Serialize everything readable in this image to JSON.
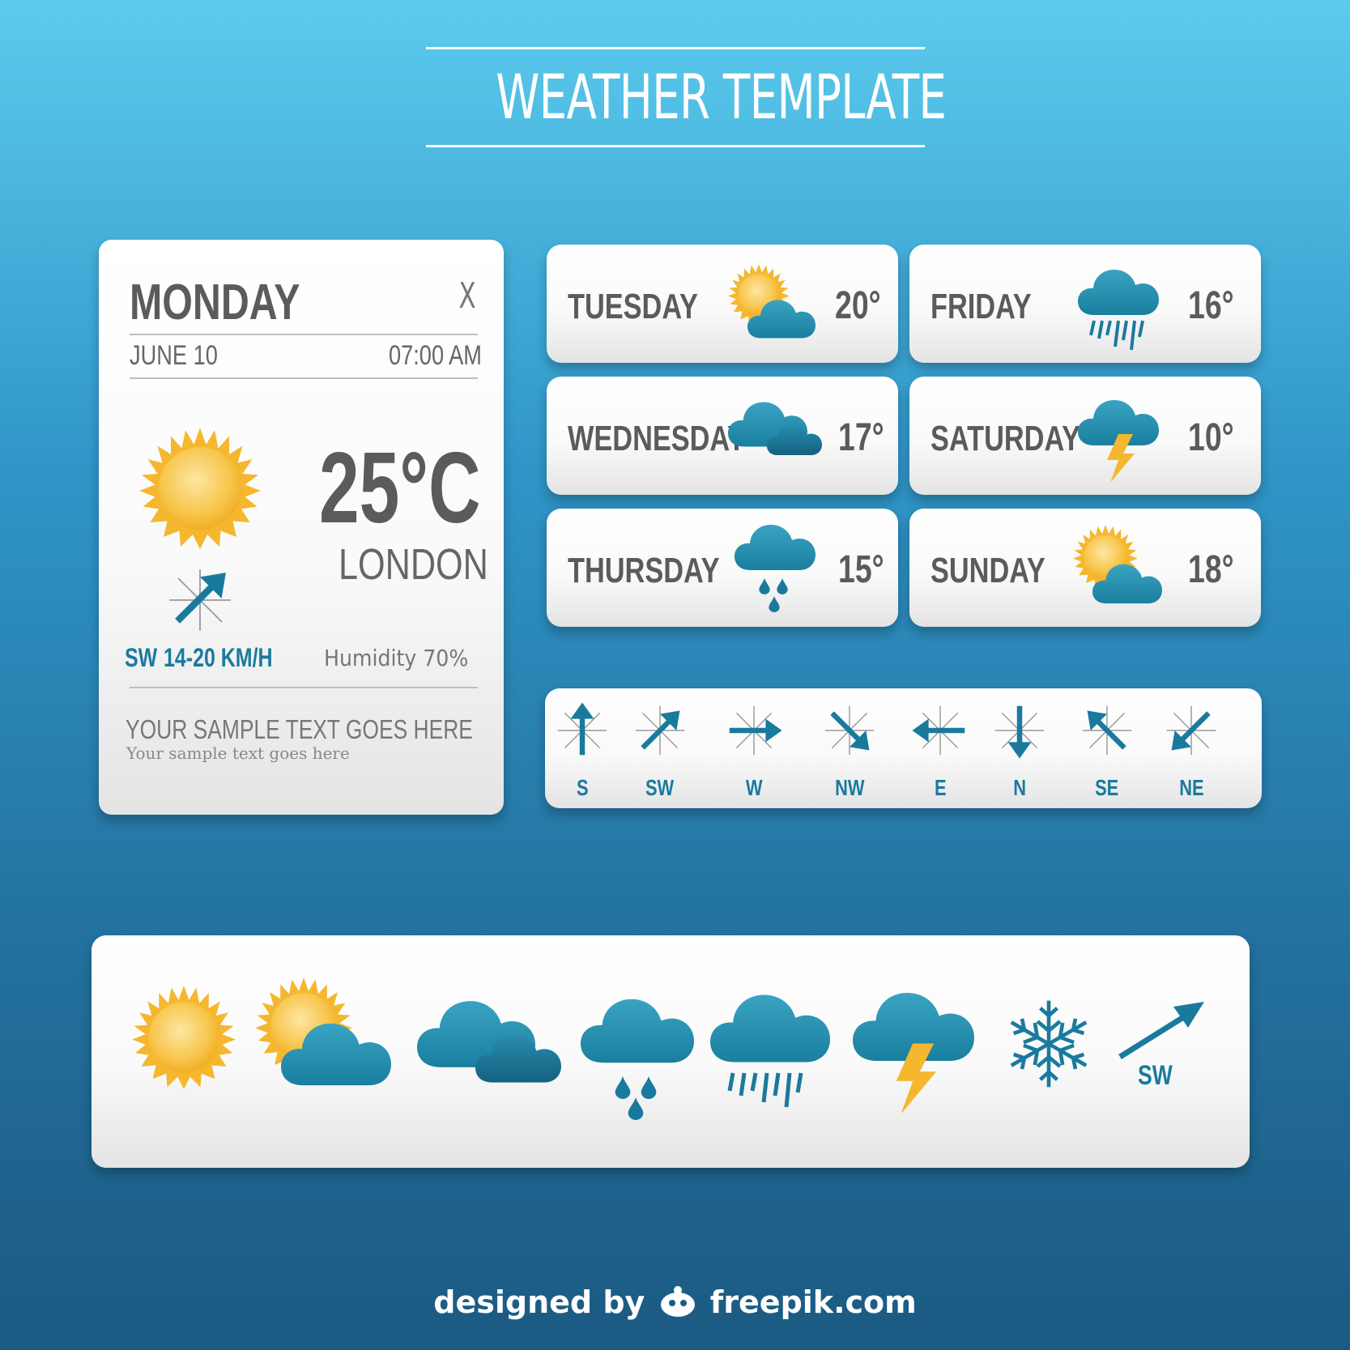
{
  "page": {
    "title": "WEATHER TEMPLATE"
  },
  "colors": {
    "teal": "#1a7a9e",
    "sun": "#f5b72e",
    "text_gray": "#5b5b5b",
    "bg_top": "#5ccbee",
    "bg_bottom": "#1b5a82"
  },
  "main_card": {
    "day": "MONDAY",
    "close": "X",
    "date": "JUNE 10",
    "time": "07:00 AM",
    "temperature": "25°C",
    "city": "LONDON",
    "wind_dir": "SW",
    "wind_speed": "14-20 KM/H",
    "humidity": "Humidity 70%",
    "sample_title": "YOUR SAMPLE TEXT GOES HERE",
    "sample_sub": "Your sample text goes here",
    "icons": {
      "weather": "sun-icon",
      "wind": "wind-arrow-icon"
    }
  },
  "forecast": [
    {
      "day": "TUESDAY",
      "temp": "20°",
      "icon": "sun-cloud-icon"
    },
    {
      "day": "FRIDAY",
      "temp": "16°",
      "icon": "heavy-rain-icon"
    },
    {
      "day": "WEDNESDAY",
      "temp": "17°",
      "icon": "clouds-icon"
    },
    {
      "day": "SATURDAY",
      "temp": "10°",
      "icon": "thunderstorm-icon"
    },
    {
      "day": "THURSDAY",
      "temp": "15°",
      "icon": "rain-drops-icon"
    },
    {
      "day": "SUNDAY",
      "temp": "18°",
      "icon": "sun-cloud-icon"
    }
  ],
  "wind_directions": [
    "S",
    "SW",
    "W",
    "NW",
    "E",
    "N",
    "SE",
    "NE"
  ],
  "icon_set": {
    "items": [
      "sun-icon",
      "sun-cloud-icon",
      "clouds-icon",
      "rain-drops-icon",
      "heavy-rain-icon",
      "thunderstorm-icon",
      "snowflake-icon",
      "wind-arrow-icon"
    ],
    "wind_label": "SW"
  },
  "footer": {
    "text": "designed by",
    "brand": "freepik.com"
  }
}
